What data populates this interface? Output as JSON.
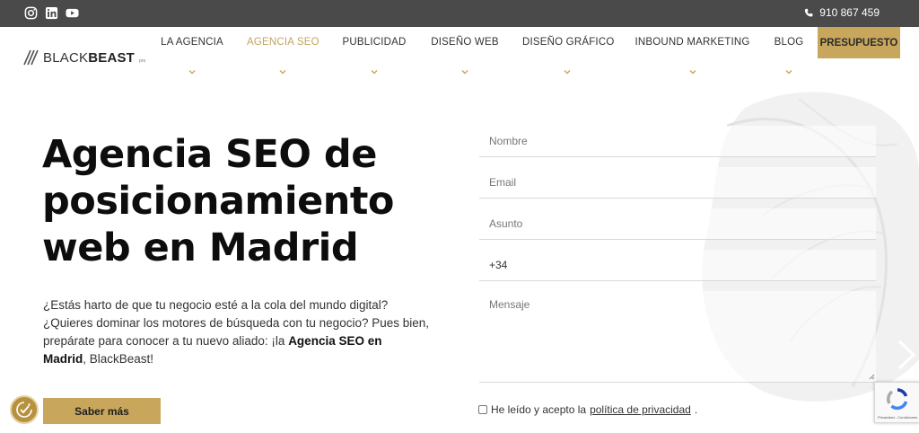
{
  "topbar": {
    "social_icons": [
      "instagram-icon",
      "linkedin-icon",
      "youtube-icon"
    ],
    "phone": "910 867 459"
  },
  "logo": {
    "text_light": "BLACK",
    "text_bold": "BEAST",
    "suffix": "pro"
  },
  "nav": {
    "items": [
      {
        "label": "LA AGENCIA"
      },
      {
        "label": "AGENCIA SEO"
      },
      {
        "label": "PUBLICIDAD"
      },
      {
        "label": "DISEÑO WEB"
      },
      {
        "label": "DISEÑO GRÁFICO"
      },
      {
        "label": "INBOUND MARKETING"
      },
      {
        "label": "BLOG"
      }
    ],
    "active": "AGENCIA SEO",
    "cta_label": "PRESUPUESTO"
  },
  "hero": {
    "title_line1": "Agencia SEO de",
    "title_line2": "posicionamiento",
    "title_line3": "web en Madrid",
    "text_part1": "¿Estás harto de que tu negocio esté a la cola del mundo digital? ¿Quieres dominar los motores de búsqueda con tu negocio? Pues bien, prepárate para conocer a tu nuevo aliado: ¡la ",
    "text_bold1": "Agencia SEO en",
    "text_bold2": "Madrid",
    "text_part2": ", BlackBeast!",
    "button_label": "Saber más"
  },
  "form": {
    "name_placeholder": "Nombre",
    "email_placeholder": "Email",
    "subject_placeholder": "Asunto",
    "phone_value": "+34",
    "message_placeholder": "Mensaje",
    "consent_text": "He leído y acepto la",
    "consent_link": "política de privacidad",
    "consent_end": "."
  },
  "recaptcha": {
    "text": "Privacidad - Condiciones"
  },
  "colors": {
    "accent_gold": "#c8a75d",
    "topbar": "#4a4a4a"
  }
}
